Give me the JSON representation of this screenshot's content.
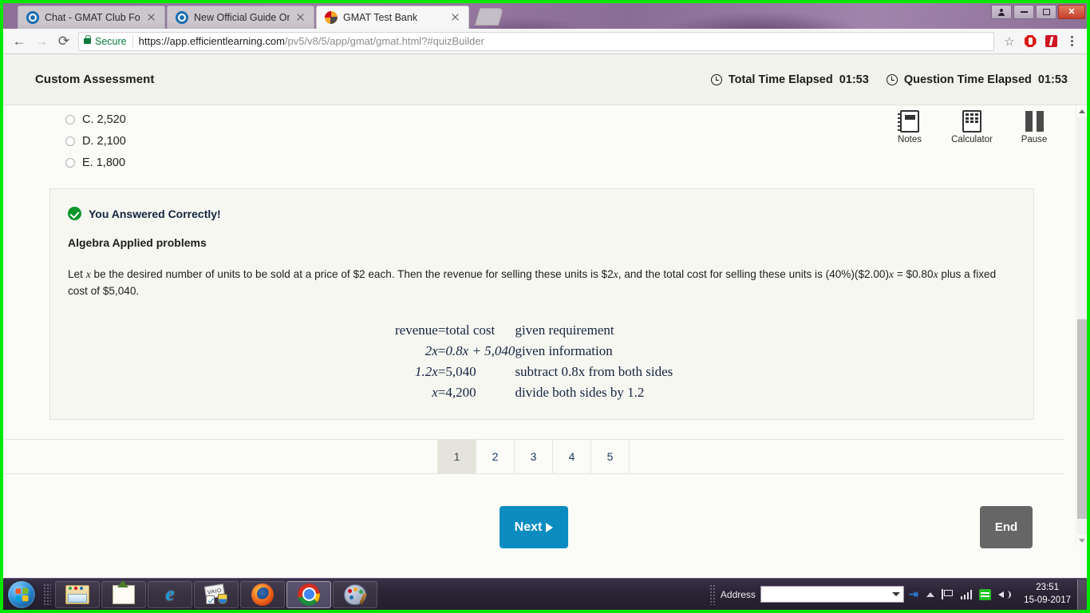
{
  "browser": {
    "tabs": [
      {
        "title": "Chat - GMAT Club Forum",
        "icon": "gmatclub-favicon",
        "active": false
      },
      {
        "title": "New Official Guide Onlin",
        "icon": "gmatclub-favicon",
        "active": false
      },
      {
        "title": "GMAT Test Bank",
        "icon": "testbank-favicon",
        "active": true
      }
    ],
    "new_tab_label": "",
    "nav": {
      "back": "←",
      "forward": "→",
      "reload": "⟳"
    },
    "omnibox": {
      "secure_label": "Secure",
      "url_strong": "https://app.efficientlearning.com",
      "url_dim": "/pv5/v8/5/app/gmat/gmat.html?#quizBuilder"
    },
    "extensions": [
      "star-icon",
      "adblock-icon",
      "flash-icon",
      "chrome-menu-icon"
    ],
    "window_controls": [
      "profile",
      "minimize",
      "maximize",
      "close"
    ]
  },
  "app": {
    "title": "Custom Assessment",
    "timers": [
      {
        "label": "Total Time Elapsed",
        "value": "01:53"
      },
      {
        "label": "Question Time Elapsed",
        "value": "01:53"
      }
    ],
    "tools": [
      {
        "label": "Notes",
        "icon": "notes-icon"
      },
      {
        "label": "Calculator",
        "icon": "calculator-icon"
      },
      {
        "label": "Pause",
        "icon": "pause-icon"
      }
    ],
    "choices": [
      {
        "label": "C. 2,520",
        "clipped": true
      },
      {
        "label": "D. 2,100",
        "clipped": false
      },
      {
        "label": "E. 1,800",
        "clipped": false
      }
    ],
    "explanation": {
      "result_text": "You Answered Correctly!",
      "topic": "Algebra Applied problems",
      "paragraph_part1": "Let ",
      "paragraph_var1": "x",
      "paragraph_part2": " be the desired number of units to be sold at a price of $2 each. Then the revenue for selling these units is $2",
      "paragraph_var2": "x",
      "paragraph_part3": ", and the total cost for selling these units is (40%)($2.00)",
      "paragraph_var3": "x",
      "paragraph_part4": " = $0.80",
      "paragraph_var4": "x",
      "paragraph_part5": " plus a fixed cost of $5,040.",
      "math_rows": [
        {
          "lhs": "revenue",
          "eq": "=",
          "rhs": "total cost",
          "note": "given requirement"
        },
        {
          "lhs": "2x",
          "eq": "=",
          "rhs": "0.8x + 5,040",
          "note": "given information"
        },
        {
          "lhs": "1.2x",
          "eq": "=",
          "rhs": "5,040",
          "note": "subtract 0.8x from both sides"
        },
        {
          "lhs": "x",
          "eq": "=",
          "rhs": "4,200",
          "note": "divide both sides by 1.2"
        }
      ]
    },
    "pagination": {
      "pages": [
        "1",
        "2",
        "3",
        "4",
        "5"
      ],
      "active": "1"
    },
    "buttons": {
      "next": "Next",
      "end": "End"
    },
    "colors": {
      "next_button": "#0b8cc0",
      "end_button": "#666666",
      "correct_check": "#0a9628"
    }
  },
  "taskbar": {
    "start_label": "Start",
    "items": [
      {
        "name": "windows-explorer",
        "icon": "explorer-icon",
        "state": "pinned"
      },
      {
        "name": "photo-viewer",
        "icon": "photo-icon",
        "state": "pinned"
      },
      {
        "name": "internet-explorer",
        "icon": "ie-icon",
        "state": "pinned"
      },
      {
        "name": "vaio-care",
        "icon": "vaio-icon",
        "state": "pinned"
      },
      {
        "name": "firefox",
        "icon": "firefox-icon",
        "state": "pinned"
      },
      {
        "name": "google-chrome",
        "icon": "chrome-icon",
        "state": "running"
      },
      {
        "name": "paint",
        "icon": "paint-icon",
        "state": "pinned"
      }
    ],
    "deskband": {
      "label": "Address",
      "value": "",
      "go_icon": "go-arrow-icon"
    },
    "tray": [
      "show-hidden-icons",
      "action-center-icon",
      "network-icon",
      "sync-icon",
      "volume-icon"
    ],
    "clock": {
      "time": "23:51",
      "date": "15-09-2017"
    }
  }
}
